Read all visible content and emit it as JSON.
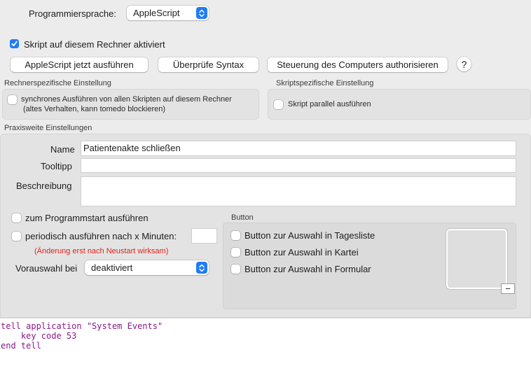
{
  "language": {
    "label": "Programmiersprache:",
    "value": "AppleScript"
  },
  "activated": {
    "label": "Skript auf diesem Rechner aktiviert",
    "checked": true
  },
  "buttons": {
    "run": "AppleScript jetzt ausführen",
    "check": "Überprüfe Syntax",
    "authorize": "Steuerung des Computers authorisieren",
    "help": "?"
  },
  "machine_settings": {
    "title": "Rechnerspezifische Einstellung",
    "sync_line1": "synchrones Ausführen von allen Skripten auf diesem Rechner",
    "sync_line2": "(altes Verhalten, kann tomedo blockieren)"
  },
  "script_settings": {
    "title": "Skriptspezifische Einstellung",
    "parallel": "Skript parallel ausführen"
  },
  "practice": {
    "title": "Praxisweite Einstellungen",
    "name_label": "Name",
    "name_value": "Patientenakte schließen",
    "tooltip_label": "Tooltipp",
    "tooltip_value": "",
    "description_label": "Beschreibung",
    "description_value": "",
    "startup": "zum Programmstart ausführen",
    "periodic": "periodisch ausführen nach x Minuten:",
    "periodic_value": "",
    "restart_note": "(Änderung erst nach Neustart wirksam)",
    "preselect_label": "Vorauswahl bei",
    "preselect_value": "deaktiviert"
  },
  "button_section": {
    "title": "Button",
    "options": [
      "Button zur Auswahl in Tagesliste",
      "Button zur Auswahl in Kartei",
      "Button zur Auswahl in Formular"
    ],
    "remove": "−"
  },
  "code": "tell application \"System Events\"\n    key code 53\nend tell",
  "colors": {
    "accent": "#1f7cf6",
    "warning": "#e0231c",
    "code": "#8a1a8a"
  }
}
